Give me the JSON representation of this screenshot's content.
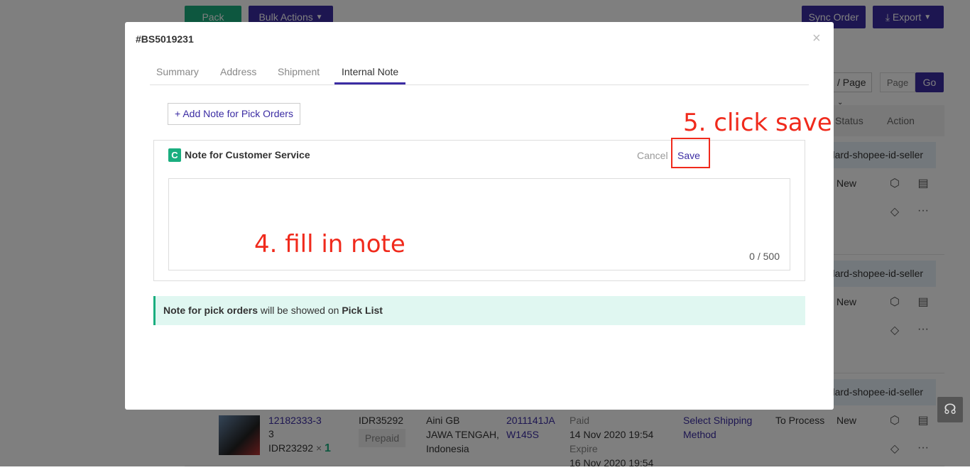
{
  "toolbar": {
    "pack": "Pack",
    "bulk_actions": "Bulk Actions",
    "sync_order": "Sync Order",
    "export": "Export"
  },
  "pagination": {
    "per_page": "/ Page",
    "page_placeholder": "Page",
    "go": "Go"
  },
  "table": {
    "headers": {
      "status": "Status",
      "action": "Action"
    },
    "shipping_label": "ndard-shopee-id-seller",
    "rows": [
      {
        "status": "New"
      },
      {
        "status": "New"
      },
      {
        "product_id": "12182333-3",
        "qty_line": "3",
        "price": "IDR23292",
        "times": "×",
        "qty": "1",
        "total": "IDR35292",
        "payment": "Prepaid",
        "customer": "Aini GB",
        "region": "JAWA TENGAH,",
        "country": "Indonesia",
        "order_no_1": "2011141JA",
        "order_no_2": "W145S",
        "paid_label": "Paid",
        "paid_date": "14 Nov 2020 19:54",
        "expire_label": "Expire",
        "expire_date": "16 Nov 2020 19:54",
        "shipping_1": "Select Shipping",
        "shipping_2": "Method",
        "process": "To Process",
        "status": "New"
      }
    ]
  },
  "modal": {
    "title": "#BS5019231",
    "tabs": [
      {
        "label": "Summary"
      },
      {
        "label": "Address"
      },
      {
        "label": "Shipment"
      },
      {
        "label": "Internal Note"
      }
    ],
    "active_tab": "Internal Note",
    "add_note_button": "+ Add Note for Pick Orders",
    "note_card": {
      "badge": "C",
      "title": "Note for Customer Service",
      "cancel": "Cancel",
      "save": "Save",
      "counter": "0 / 500",
      "value": ""
    },
    "info": {
      "part1": "Note for pick orders",
      "part2": " will be showed on ",
      "part3": "Pick List"
    }
  },
  "annotations": {
    "step4": "4. fill in note",
    "step5": "5. click save"
  },
  "colors": {
    "primary": "#3b2ca3",
    "green": "#1aae7f",
    "annotation": "#f02a1c",
    "info_bg": "#e0f7f1"
  }
}
